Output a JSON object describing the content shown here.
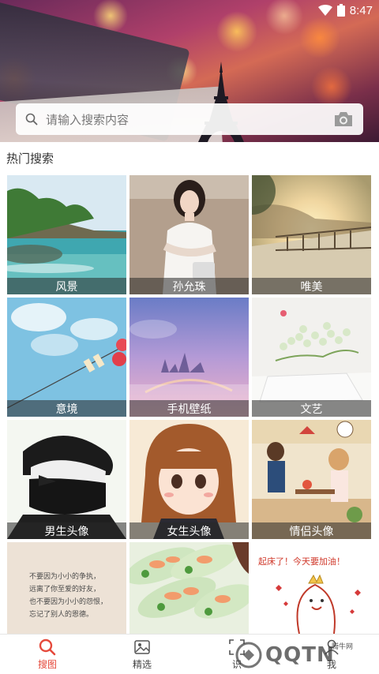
{
  "status": {
    "time": "8:47"
  },
  "search": {
    "placeholder": "请输入搜索内容"
  },
  "section": {
    "title": "热门搜索"
  },
  "tiles": [
    {
      "label": "风景"
    },
    {
      "label": "孙允珠"
    },
    {
      "label": "唯美"
    },
    {
      "label": "意境"
    },
    {
      "label": "手机壁纸"
    },
    {
      "label": "文艺"
    },
    {
      "label": "男生头像"
    },
    {
      "label": "女生头像"
    },
    {
      "label": "情侣头像"
    },
    {
      "text_lines": [
        "不要因为小小的争执，",
        "远离了你至爱的好友，",
        "也不要因为小小的怨恨，",
        "忘记了别人的恩德。"
      ]
    },
    {
      "label": ""
    },
    {
      "text": "起床了！今天要加油！"
    }
  ],
  "nav": {
    "items": [
      {
        "label": "搜图",
        "icon": "search-icon",
        "active": true
      },
      {
        "label": "精选",
        "icon": "image-icon",
        "active": false
      },
      {
        "label": "识",
        "icon": "scan-icon",
        "active": false
      },
      {
        "label": "我",
        "icon": "user-icon",
        "active": false
      }
    ]
  },
  "watermark": {
    "text": "QQTN",
    "small": "腾牛网"
  },
  "colors": {
    "accent": "#e5493b"
  }
}
